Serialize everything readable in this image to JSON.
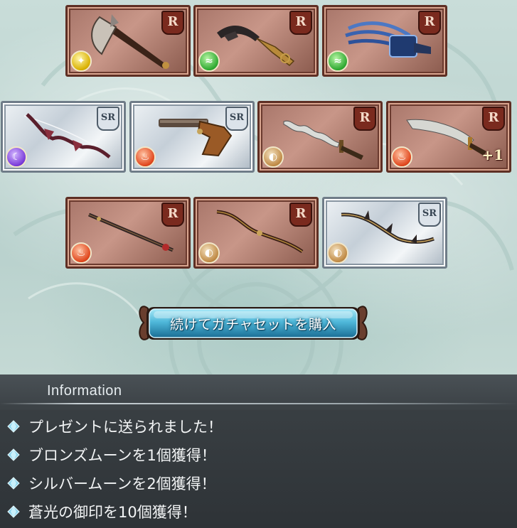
{
  "results": {
    "cards": [
      {
        "rarity": "R",
        "element": "light",
        "weapon": "axe-icon",
        "bonus": ""
      },
      {
        "rarity": "R",
        "element": "wind",
        "weapon": "scythe-blade-icon",
        "bonus": ""
      },
      {
        "rarity": "R",
        "element": "wind",
        "weapon": "claw-icon",
        "bonus": ""
      },
      {
        "rarity": "SR",
        "element": "dark",
        "weapon": "bow-icon",
        "bonus": ""
      },
      {
        "rarity": "SR",
        "element": "fire",
        "weapon": "flintlock-pistol-icon",
        "bonus": ""
      },
      {
        "rarity": "R",
        "element": "earth",
        "weapon": "wavy-sword-icon",
        "bonus": ""
      },
      {
        "rarity": "R",
        "element": "fire",
        "weapon": "scimitar-icon",
        "bonus": "+1"
      },
      {
        "rarity": "R",
        "element": "fire",
        "weapon": "staff-icon",
        "bonus": ""
      },
      {
        "rarity": "R",
        "element": "earth",
        "weapon": "curved-bow-icon",
        "bonus": ""
      },
      {
        "rarity": "SR",
        "element": "earth",
        "weapon": "thorn-bow-icon",
        "bonus": ""
      }
    ]
  },
  "buy_button": {
    "label": "続けてガチャセットを購入"
  },
  "information": {
    "title": "Information",
    "messages": [
      "プレゼントに送られました！",
      "ブロンズムーンを1個獲得！",
      "シルバームーンを2個獲得！",
      "蒼光の御印を10個獲得！"
    ]
  },
  "colors": {
    "r_card": "#a8766a",
    "sr_card": "#c5cfd8",
    "button_accent": "#4fb8da",
    "info_panel": "#353b3f"
  }
}
